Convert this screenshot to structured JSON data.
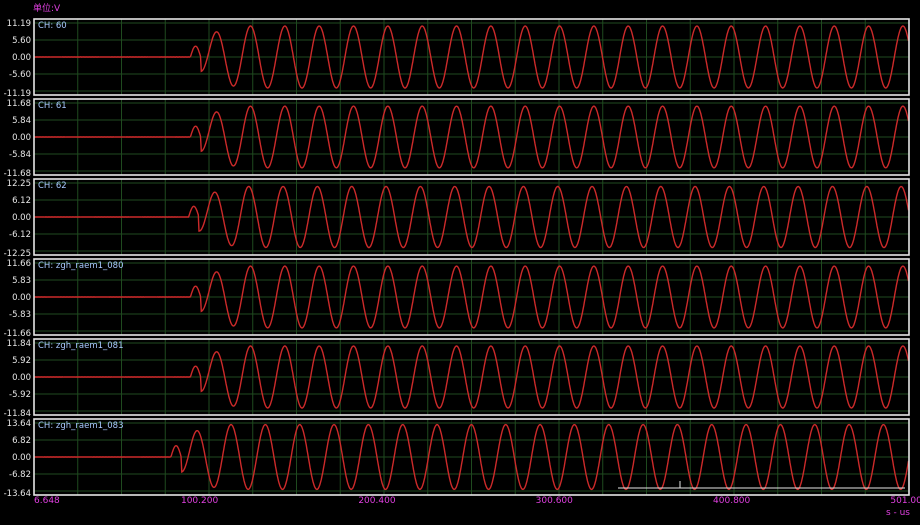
{
  "unit_label": "单位:V",
  "x_unit_label": "s - us",
  "colors": {
    "background": "#000000",
    "grid": "#1f4a1f",
    "trace": "#cc2a2a",
    "frame": "#e6e6e6",
    "axis_text": "#e040e0",
    "channel_text": "#a8c8ff"
  },
  "chart_data": [
    {
      "type": "line",
      "channel": "CH: 60",
      "y_ticks": [
        "11.19",
        "5.60",
        "0.00",
        "-5.60",
        "-11.19"
      ],
      "ylim": [
        -11.19,
        11.19
      ],
      "amplitude": 10.2,
      "onset": 95
    },
    {
      "type": "line",
      "channel": "CH: 61",
      "y_ticks": [
        "11.68",
        "5.84",
        "0.00",
        "-5.84",
        "-11.68"
      ],
      "ylim": [
        -11.68,
        11.68
      ],
      "amplitude": 10.6,
      "onset": 95
    },
    {
      "type": "line",
      "channel": "CH: 62",
      "y_ticks": [
        "12.25",
        "6.12",
        "0.00",
        "-6.12",
        "-12.25"
      ],
      "ylim": [
        -12.25,
        12.25
      ],
      "amplitude": 11.0,
      "onset": 94
    },
    {
      "type": "line",
      "channel": "CH: zgh_raem1_080",
      "y_ticks": [
        "11.66",
        "5.83",
        "0.00",
        "-5.83",
        "-11.66"
      ],
      "ylim": [
        -11.66,
        11.66
      ],
      "amplitude": 10.6,
      "onset": 95
    },
    {
      "type": "line",
      "channel": "CH: zgh_raem1_081",
      "y_ticks": [
        "11.84",
        "5.92",
        "0.00",
        "-5.92",
        "-11.84"
      ],
      "ylim": [
        -11.84,
        11.84
      ],
      "amplitude": 10.8,
      "onset": 95
    },
    {
      "type": "line",
      "channel": "CH: zgh_raem1_083",
      "y_ticks": [
        "13.64",
        "6.82",
        "0.00",
        "-6.82",
        "-13.64"
      ],
      "ylim": [
        -13.64,
        13.64
      ],
      "amplitude": 13.0,
      "onset": 84
    }
  ],
  "x_axis": {
    "ticks": [
      "6.648",
      "100.200",
      "200.400",
      "300.600",
      "400.800",
      "501.000"
    ],
    "tick_values": [
      6.648,
      100.2,
      200.4,
      300.6,
      400.8,
      501.0
    ],
    "xlim": [
      6.648,
      501.0
    ],
    "unit": "s - us",
    "period_us": 19.4
  }
}
